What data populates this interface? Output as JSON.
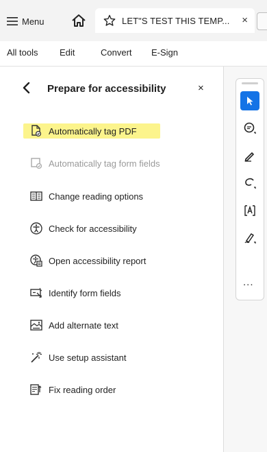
{
  "tabbar": {
    "menu_label": "Menu",
    "tab_title": "LET\"S TEST THIS TEMP...",
    "close_glyph": "×"
  },
  "menubar": {
    "items": [
      "All tools",
      "Edit",
      "Convert",
      "E-Sign"
    ]
  },
  "panel": {
    "title": "Prepare for accessibility",
    "close_glyph": "×",
    "items": [
      {
        "label": "Automatically tag PDF",
        "icon": "tag-pdf-icon",
        "highlighted": true,
        "enabled": true
      },
      {
        "label": "Automatically tag form fields",
        "icon": "tag-form-fields-icon",
        "highlighted": false,
        "enabled": false
      },
      {
        "label": "Change reading options",
        "icon": "reading-options-icon",
        "highlighted": false,
        "enabled": true
      },
      {
        "label": "Check for accessibility",
        "icon": "accessibility-check-icon",
        "highlighted": false,
        "enabled": true
      },
      {
        "label": "Open accessibility report",
        "icon": "accessibility-report-icon",
        "highlighted": false,
        "enabled": true
      },
      {
        "label": "Identify form fields",
        "icon": "identify-form-fields-icon",
        "highlighted": false,
        "enabled": true
      },
      {
        "label": "Add alternate text",
        "icon": "alternate-text-icon",
        "highlighted": false,
        "enabled": true
      },
      {
        "label": "Use setup assistant",
        "icon": "setup-assistant-icon",
        "highlighted": false,
        "enabled": true
      },
      {
        "label": "Fix reading order",
        "icon": "reading-order-icon",
        "highlighted": false,
        "enabled": true
      }
    ]
  },
  "rail": {
    "tools": [
      "select-cursor-icon",
      "comment-icon",
      "pencil-icon",
      "lasso-icon",
      "text-select-icon",
      "sign-icon"
    ],
    "more_label": "..."
  },
  "colors": {
    "accent": "#1473e6",
    "highlight": "#fcf48c",
    "disabled_text": "#9a9a9a"
  }
}
